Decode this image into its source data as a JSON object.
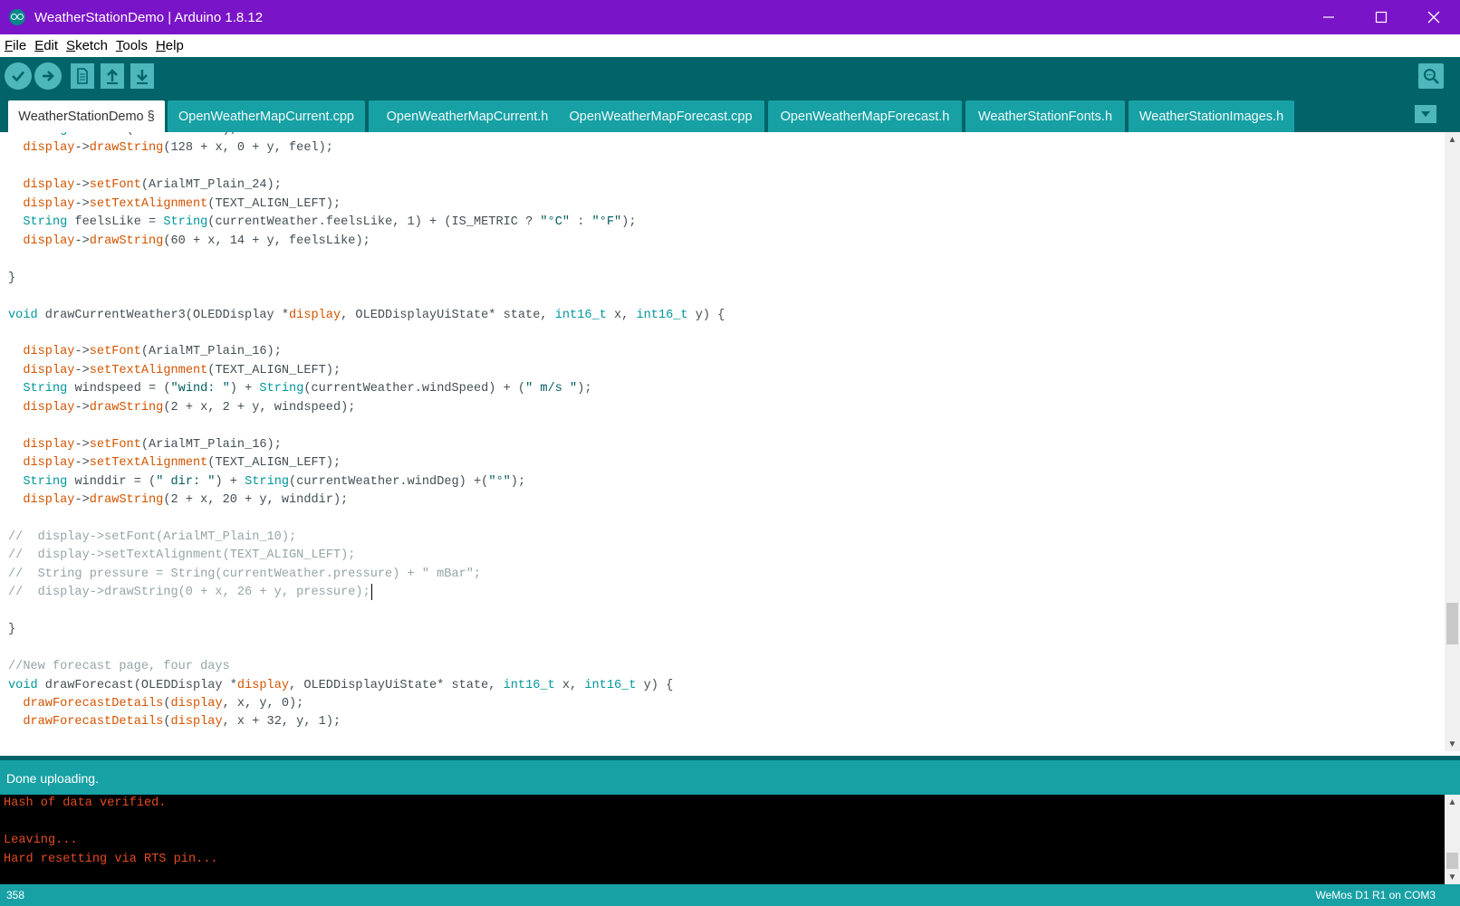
{
  "window": {
    "title": "WeatherStationDemo | Arduino 1.8.12",
    "controls": [
      "minimize",
      "maximize",
      "close"
    ]
  },
  "menu": [
    {
      "label": "File",
      "mnemonic": "F",
      "rest": "ile"
    },
    {
      "label": "Edit",
      "mnemonic": "E",
      "rest": "dit"
    },
    {
      "label": "Sketch",
      "mnemonic": "S",
      "rest": "ketch"
    },
    {
      "label": "Tools",
      "mnemonic": "T",
      "rest": "ools"
    },
    {
      "label": "Help",
      "mnemonic": "H",
      "rest": "elp"
    }
  ],
  "toolbar": {
    "buttons": [
      "verify-icon",
      "upload-icon",
      "new-icon",
      "open-icon",
      "save-icon"
    ],
    "right_button": "serial-monitor-icon"
  },
  "tabs": [
    "WeatherStationDemo §",
    "OpenWeatherMapCurrent.cpp",
    "OpenWeatherMapCurrent.h",
    "OpenWeatherMapForecast.cpp",
    "OpenWeatherMapForecast.h",
    "WeatherStationFonts.h",
    "WeatherStationImages.h"
  ],
  "active_tab_index": 0,
  "code": [
    [
      {
        "t": "  "
      },
      {
        "t": "String",
        "c": "type"
      },
      {
        "t": " feel = ("
      },
      {
        "t": "\"Feels like\"",
        "c": "str"
      },
      {
        "t": ");"
      }
    ],
    [
      {
        "t": "  "
      },
      {
        "t": "display",
        "c": "kw"
      },
      {
        "t": "->"
      },
      {
        "t": "drawString",
        "c": "kw"
      },
      {
        "t": "(128 + x, 0 + y, feel);"
      }
    ],
    [],
    [
      {
        "t": "  "
      },
      {
        "t": "display",
        "c": "kw"
      },
      {
        "t": "->"
      },
      {
        "t": "setFont",
        "c": "kw"
      },
      {
        "t": "(ArialMT_Plain_24);"
      }
    ],
    [
      {
        "t": "  "
      },
      {
        "t": "display",
        "c": "kw"
      },
      {
        "t": "->"
      },
      {
        "t": "setTextAlignment",
        "c": "kw"
      },
      {
        "t": "(TEXT_ALIGN_LEFT);"
      }
    ],
    [
      {
        "t": "  "
      },
      {
        "t": "String",
        "c": "type"
      },
      {
        "t": " feelsLike = "
      },
      {
        "t": "String",
        "c": "type"
      },
      {
        "t": "(currentWeather.feelsLike, 1) + (IS_METRIC ? "
      },
      {
        "t": "\"°C\"",
        "c": "str"
      },
      {
        "t": " : "
      },
      {
        "t": "\"°F\"",
        "c": "str"
      },
      {
        "t": ");"
      }
    ],
    [
      {
        "t": "  "
      },
      {
        "t": "display",
        "c": "kw"
      },
      {
        "t": "->"
      },
      {
        "t": "drawString",
        "c": "kw"
      },
      {
        "t": "(60 + x, 14 + y, feelsLike);"
      }
    ],
    [],
    [
      {
        "t": "}"
      }
    ],
    [],
    [
      {
        "t": "void",
        "c": "type"
      },
      {
        "t": " drawCurrentWeather3(OLEDDisplay *"
      },
      {
        "t": "display",
        "c": "kw"
      },
      {
        "t": ", OLEDDisplayUiState* state, "
      },
      {
        "t": "int16_t",
        "c": "type"
      },
      {
        "t": " x, "
      },
      {
        "t": "int16_t",
        "c": "type"
      },
      {
        "t": " y) {"
      }
    ],
    [],
    [
      {
        "t": "  "
      },
      {
        "t": "display",
        "c": "kw"
      },
      {
        "t": "->"
      },
      {
        "t": "setFont",
        "c": "kw"
      },
      {
        "t": "(ArialMT_Plain_16);"
      }
    ],
    [
      {
        "t": "  "
      },
      {
        "t": "display",
        "c": "kw"
      },
      {
        "t": "->"
      },
      {
        "t": "setTextAlignment",
        "c": "kw"
      },
      {
        "t": "(TEXT_ALIGN_LEFT);"
      }
    ],
    [
      {
        "t": "  "
      },
      {
        "t": "String",
        "c": "type"
      },
      {
        "t": " windspeed = ("
      },
      {
        "t": "\"wind: \"",
        "c": "str"
      },
      {
        "t": ") + "
      },
      {
        "t": "String",
        "c": "type"
      },
      {
        "t": "(currentWeather.windSpeed) + ("
      },
      {
        "t": "\" m/s \"",
        "c": "str"
      },
      {
        "t": ");"
      }
    ],
    [
      {
        "t": "  "
      },
      {
        "t": "display",
        "c": "kw"
      },
      {
        "t": "->"
      },
      {
        "t": "drawString",
        "c": "kw"
      },
      {
        "t": "(2 + x, 2 + y, windspeed);"
      }
    ],
    [],
    [
      {
        "t": "  "
      },
      {
        "t": "display",
        "c": "kw"
      },
      {
        "t": "->"
      },
      {
        "t": "setFont",
        "c": "kw"
      },
      {
        "t": "(ArialMT_Plain_16);"
      }
    ],
    [
      {
        "t": "  "
      },
      {
        "t": "display",
        "c": "kw"
      },
      {
        "t": "->"
      },
      {
        "t": "setTextAlignment",
        "c": "kw"
      },
      {
        "t": "(TEXT_ALIGN_LEFT);"
      }
    ],
    [
      {
        "t": "  "
      },
      {
        "t": "String",
        "c": "type"
      },
      {
        "t": " winddir = ("
      },
      {
        "t": "\" dir: \"",
        "c": "str"
      },
      {
        "t": ") + "
      },
      {
        "t": "String",
        "c": "type"
      },
      {
        "t": "(currentWeather.windDeg) +("
      },
      {
        "t": "\"°\"",
        "c": "str"
      },
      {
        "t": ");"
      }
    ],
    [
      {
        "t": "  "
      },
      {
        "t": "display",
        "c": "kw"
      },
      {
        "t": "->"
      },
      {
        "t": "drawString",
        "c": "kw"
      },
      {
        "t": "(2 + x, 20 + y, winddir);"
      }
    ],
    [],
    [
      {
        "t": "//  display->setFont(ArialMT_Plain_10);",
        "c": "comment"
      }
    ],
    [
      {
        "t": "//  display->setTextAlignment(TEXT_ALIGN_LEFT);",
        "c": "comment"
      }
    ],
    [
      {
        "t": "//  String pressure = String(currentWeather.pressure) + \" mBar\";",
        "c": "comment"
      }
    ],
    [
      {
        "t": "//  display->drawString(0 + x, 26 + y, pressure);",
        "c": "comment"
      },
      {
        "caret": true
      }
    ],
    [],
    [
      {
        "t": "}"
      }
    ],
    [],
    [
      {
        "t": "//New forecast page, four days",
        "c": "comment"
      }
    ],
    [
      {
        "t": "void",
        "c": "type"
      },
      {
        "t": " drawForecast(OLEDDisplay *"
      },
      {
        "t": "display",
        "c": "kw"
      },
      {
        "t": ", OLEDDisplayUiState* state, "
      },
      {
        "t": "int16_t",
        "c": "type"
      },
      {
        "t": " x, "
      },
      {
        "t": "int16_t",
        "c": "type"
      },
      {
        "t": " y) {"
      }
    ],
    [
      {
        "t": "  "
      },
      {
        "t": "drawForecastDetails",
        "c": "kw"
      },
      {
        "t": "("
      },
      {
        "t": "display",
        "c": "kw"
      },
      {
        "t": ", x, y, 0);"
      }
    ],
    [
      {
        "t": "  "
      },
      {
        "t": "drawForecastDetails",
        "c": "kw"
      },
      {
        "t": "("
      },
      {
        "t": "display",
        "c": "kw"
      },
      {
        "t": ", x + 32, y, 1);"
      }
    ]
  ],
  "status": {
    "message": "Done uploading."
  },
  "console": [
    "Hash of data verified.",
    "",
    "Leaving...",
    "Hard resetting via RTS pin..."
  ],
  "footer": {
    "line_number": "358",
    "board": "WeMos D1 R1 on COM3"
  },
  "colors": {
    "titlebar": "#7a14c8",
    "toolbar": "#006468",
    "tab": "#17a1a5",
    "keyword": "#d35400",
    "type": "#00979c",
    "string": "#005c5f",
    "comment": "#95a5a6",
    "console_text": "#e34c22"
  }
}
